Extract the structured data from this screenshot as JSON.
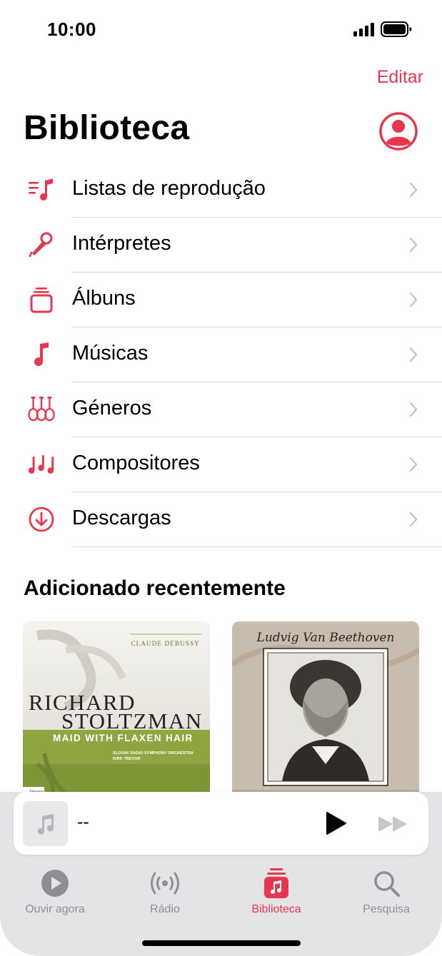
{
  "status": {
    "time": "10:00"
  },
  "header": {
    "edit_label": "Editar",
    "title": "Biblioteca",
    "account_icon": "person-circle-icon"
  },
  "menu": {
    "items": [
      {
        "label": "Listas de reprodução",
        "icon": "playlist-icon"
      },
      {
        "label": "Intérpretes",
        "icon": "microphone-icon"
      },
      {
        "label": "Álbuns",
        "icon": "album-stack-icon"
      },
      {
        "label": "Músicas",
        "icon": "music-note-icon"
      },
      {
        "label": "Géneros",
        "icon": "guitars-icon"
      },
      {
        "label": "Compositores",
        "icon": "music-notes-icon"
      },
      {
        "label": "Descargas",
        "icon": "download-circle-icon"
      }
    ]
  },
  "recent": {
    "title": "Adicionado recentemente",
    "albums": [
      {
        "composer": "CLAUDE DEBUSSY",
        "artist_line1": "RICHARD",
        "artist_line2": "STOLTZMAN",
        "album_title": "MAID WITH FLAXEN HAIR",
        "orchestra": "SLOVAK RADIO SYMPHONY ORCHESTRA",
        "conductor": "KIRK TREVOR",
        "label_text": "Navona"
      },
      {
        "composer": "Ludvig Van Beethoven"
      }
    ]
  },
  "mini_player": {
    "title": "--"
  },
  "tabs": [
    {
      "label": "Ouvir agora",
      "icon": "play-circle-icon",
      "active": false
    },
    {
      "label": "Rádio",
      "icon": "radio-waves-icon",
      "active": false
    },
    {
      "label": "Biblioteca",
      "icon": "library-icon",
      "active": true
    },
    {
      "label": "Pesquisa",
      "icon": "search-icon",
      "active": false
    }
  ],
  "colors": {
    "accent": "#e8364e",
    "separator": "#d9d9dc",
    "tab_inactive": "#8e8e93"
  }
}
